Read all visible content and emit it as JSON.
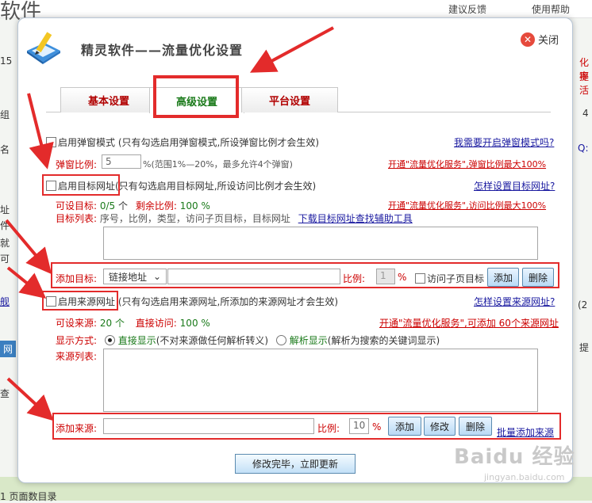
{
  "background": {
    "title": "软件",
    "links": [
      "建议反馈",
      "使用帮助"
    ],
    "left_fragments": [
      "15",
      "组",
      "名",
      "址",
      "件",
      "就",
      "可",
      "舰",
      "网",
      "查"
    ],
    "right_fragments": [
      "化率",
      "提活",
      "4",
      "Q:",
      "(2",
      "提"
    ],
    "bottom_text": "1 页面数目录"
  },
  "dialog": {
    "title": "精灵软件——流量优化设置",
    "close_label": "关闭",
    "tabs": [
      {
        "label": "基本设置",
        "active": false
      },
      {
        "label": "高级设置",
        "active": true
      },
      {
        "label": "平台设置",
        "active": false
      }
    ],
    "popup": {
      "enable_label": "启用弹窗模式",
      "note": "(只有勾选启用弹窗模式,所设弹窗比例才会生效)",
      "help_link": "我需要开启弹窗模式吗?",
      "ratio_label": "弹窗比例:",
      "ratio_value": "5",
      "ratio_hint": "%(范围1%—20%，最多允许4个弹窗)",
      "promo": "开通\"流量优化服务\",弹窗比例最大100%"
    },
    "target": {
      "enable_label": "启用目标网址",
      "note": "(只有勾选启用目标网址,所设访问比例才会生效)",
      "help_link": "怎样设置目标网址?",
      "settable_label": "可设目标:",
      "settable_value": "0/5",
      "settable_unit": "个",
      "remain_label": "剩余比例:",
      "remain_value": "100 %",
      "promo": "开通\"流量优化服务\",访问比例最大100%",
      "list_label": "目标列表:",
      "list_columns": "序号，比例，类型，访问子页目标，目标网址",
      "tool_link": "下载目标网址查找辅助工具",
      "add_label": "添加目标:",
      "type_select": "链接地址",
      "url_value": "",
      "ratio_label": "比例:",
      "ratio_value": "1",
      "percent": "%",
      "subpage_label": "访问子页目标",
      "add_button": "添加",
      "delete_button": "删除"
    },
    "source": {
      "enable_label": "启用来源网址",
      "note": "(只有勾选启用来源网址,所添加的来源网址才会生效)",
      "help_link": "怎样设置来源网址?",
      "settable_label": "可设来源:",
      "settable_value": "20 个",
      "direct_label": "直接访问:",
      "direct_value": "100 %",
      "promo": "开通\"流量优化服务\",可添加 60个来源网址",
      "display_label": "显示方式:",
      "display_opt1": "直接显示",
      "display_opt1_note": "(不对来源做任何解析转义)",
      "display_opt2": "解析显示",
      "display_opt2_note": "(解析为搜索的关键词显示)",
      "list_label": "来源列表:",
      "add_label": "添加来源:",
      "url_value": "",
      "ratio_label": "比例:",
      "ratio_value": "10",
      "percent": "%",
      "add_button": "添加",
      "edit_button": "修改",
      "delete_button": "删除",
      "batch_link": "批量添加来源"
    },
    "submit_label": "修改完毕，立即更新"
  },
  "watermark": {
    "text": "Baidu 经验",
    "sub": "jingyan.baidu.com"
  },
  "colors": {
    "annotation_red": "#e32b2b",
    "link_blue": "#1a1aa0",
    "accent_red": "#cc0000",
    "accent_green": "#1a7a1a"
  }
}
